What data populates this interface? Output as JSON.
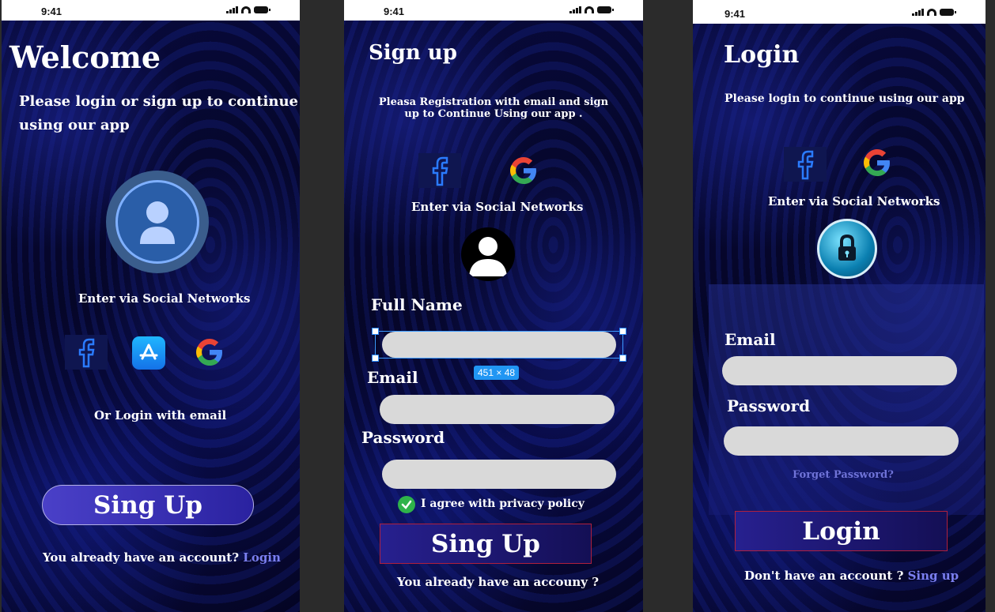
{
  "status": {
    "time": "9:41"
  },
  "welcome": {
    "title": "Welcome",
    "subtitle_line1": "Please login or sign up  to continue",
    "subtitle_line2": "using our app",
    "social_label": "Enter via Social Networks",
    "email_label": "Or Login with email",
    "signup_button": "Sing Up",
    "account_text": "You already have an account?",
    "login_link": "Login"
  },
  "signup": {
    "title": "Sign up",
    "subtitle_line1": "Pleasa Registration with email and sign",
    "subtitle_line2": "up to Continue Using our app .",
    "social_label": "Enter via Social Networks",
    "fullname_label": "Full Name",
    "email_label": "Email",
    "password_label": "Password",
    "size_badge": "451 × 48",
    "agree_text": "I agree with privacy policy",
    "signup_button": "Sing Up",
    "account_text": "You already have an accouny ?"
  },
  "login": {
    "title": "Login",
    "subtitle": "Please login to continue  using our app",
    "social_label": "Enter via Social Networks",
    "email_label": "Email",
    "password_label": "Password",
    "forgot_link": "Forget Password?",
    "login_button": "Login",
    "no_account_text": "Don't have an account ?",
    "signup_link": "Sing up"
  },
  "colors": {
    "link": "#7b7ff0",
    "field": "#d9d9d9",
    "accent_blue": "#2196f3"
  },
  "icons": [
    "facebook-icon",
    "app-store-icon",
    "google-icon",
    "user-avatar-icon",
    "lock-icon",
    "check-icon"
  ]
}
